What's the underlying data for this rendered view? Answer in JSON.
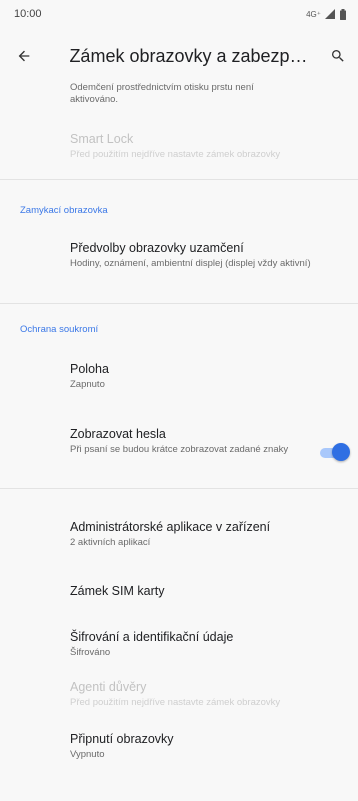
{
  "status_bar": {
    "time": "10:00",
    "network": "4G⁺"
  },
  "app_bar": {
    "title": "Zámek obrazovky a zabezpeč..."
  },
  "items": {
    "partial": {
      "summary_line1": "Odemčení prostřednictvím otisku prstu není",
      "summary_line2": "aktivováno."
    },
    "smart_lock": {
      "title": "Smart Lock",
      "summary": "Před použitím nejdříve nastavte zámek obrazovky"
    },
    "lock_prefs": {
      "title": "Předvolby obrazovky uzamčení",
      "summary": "Hodiny, oznámení, ambientní displej (displej vždy aktivní)"
    },
    "location": {
      "title": "Poloha",
      "summary": "Zapnuto"
    },
    "show_passwords": {
      "title": "Zobrazovat hesla",
      "summary": "Při psaní se budou krátce zobrazovat zadané znaky",
      "enabled": true
    },
    "device_admin": {
      "title": "Administrátorské aplikace v zařízení",
      "summary": "2 aktivních aplikací"
    },
    "sim_lock": {
      "title": "Zámek SIM karty"
    },
    "encryption": {
      "title": "Šifrování a identifikační údaje",
      "summary": "Šifrováno"
    },
    "trust_agents": {
      "title": "Agenti důvěry",
      "summary": "Před použitím nejdříve nastavte zámek obrazovky"
    },
    "screen_pinning": {
      "title": "Připnutí obrazovky",
      "summary": "Vypnuto"
    }
  },
  "categories": {
    "lock_screen": "Zamykací obrazovka",
    "privacy": "Ochrana soukromí"
  },
  "colors": {
    "accent": "#3b78e7",
    "toggle_thumb": "#2f6fe3",
    "toggle_track": "#a9c8fb"
  }
}
